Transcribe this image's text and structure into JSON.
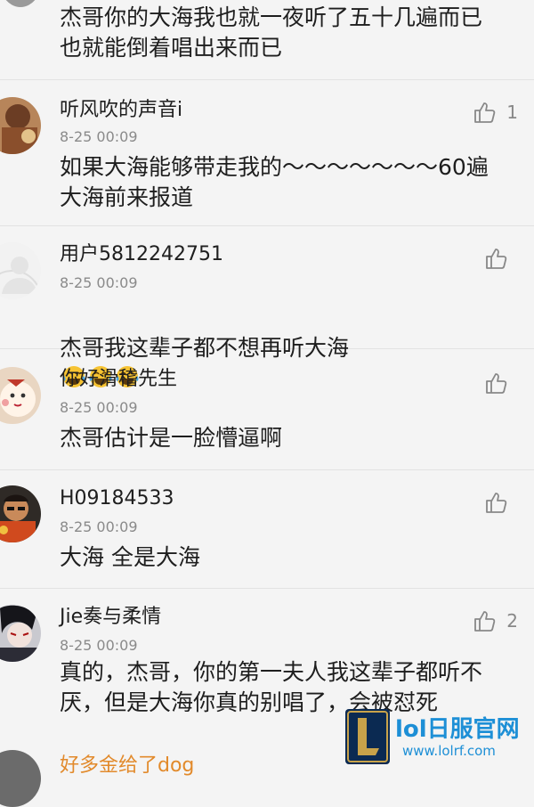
{
  "top_comment": {
    "text": "杰哥你的大海我也就一夜听了五十几遍而已\n也就能倒着唱出来而已"
  },
  "comments": [
    {
      "username": "听风吹的声音i",
      "time": "8-25 00:09",
      "text": "如果大海能够带走我的～～～～～～～60遍\n大海前来报道",
      "likes": "1"
    },
    {
      "username": "用户5812242751",
      "time": "8-25 00:09",
      "text": "杰哥我这辈子都不想再听大海",
      "likes": ""
    },
    {
      "username": "你好滑稽先生",
      "time": "8-25 00:09",
      "text": "杰哥估计是一脸懵逼啊",
      "likes": ""
    },
    {
      "username": "H09184533",
      "time": "8-25 00:09",
      "text": "大海 全是大海",
      "likes": ""
    },
    {
      "username": "Jie奏与柔情",
      "time": "8-25 00:09",
      "text": "真的，杰哥，你的第一夫人我这辈子都听不\n厌，但是大海你真的别唱了，会被怼死",
      "likes": "2"
    }
  ],
  "partial_next": {
    "username": "好多金给了dog"
  },
  "watermark": {
    "title": "lol日服官网",
    "url": "www.lolrf.com"
  },
  "icons": {
    "like": "thumbs-up-icon",
    "emoji": "tears-of-joy-emoji"
  },
  "colors": {
    "background": "#f4f4f4",
    "divider": "#e2e2e2",
    "watermark": "#1d8fd6"
  }
}
